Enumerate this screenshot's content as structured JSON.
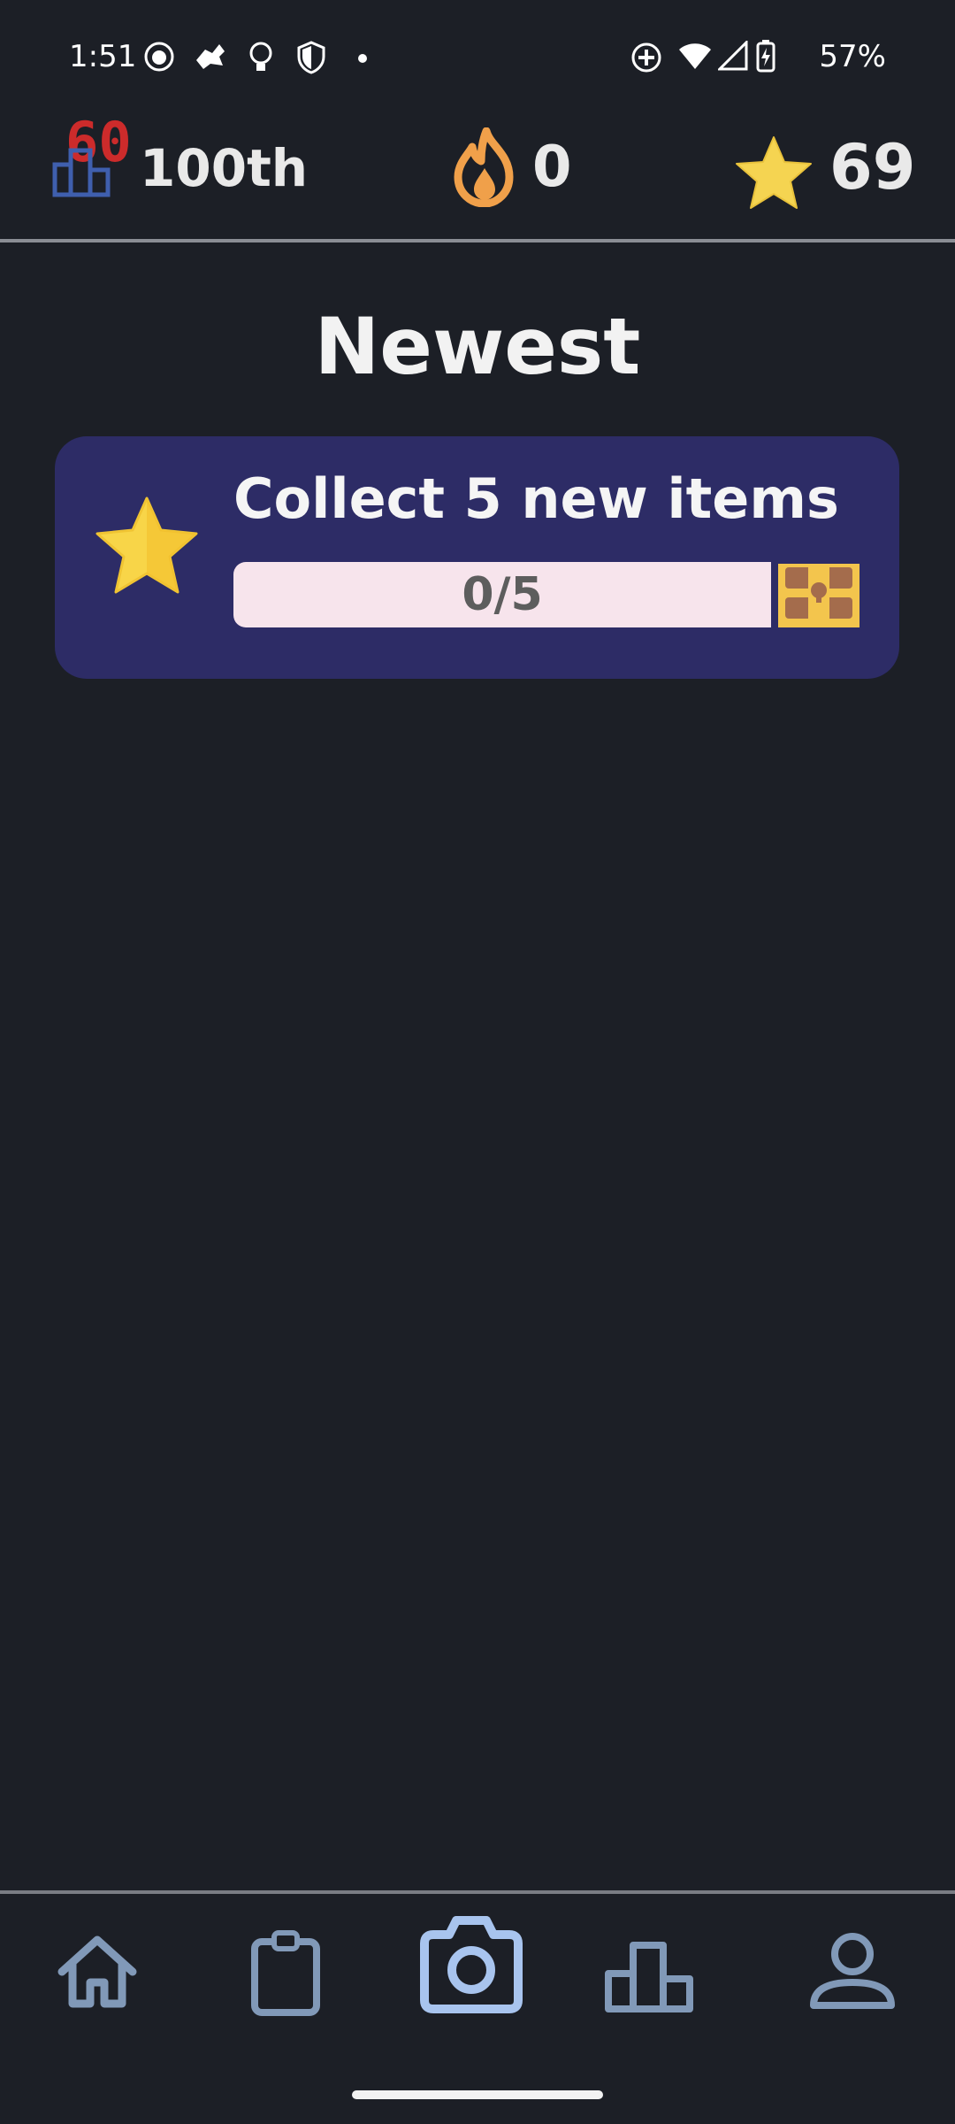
{
  "status_bar": {
    "time": "1:51",
    "battery": "57%",
    "icons_left": [
      "cat-icon",
      "bird-icon",
      "lightbulb-icon",
      "shield-icon",
      "dot-icon"
    ],
    "icons_right": [
      "location-icon",
      "wifi-icon",
      "cell-signal-icon",
      "battery-charging-icon"
    ]
  },
  "stats": {
    "rank": "100th",
    "rank_badge": "60",
    "streak": "0",
    "stars": "69"
  },
  "main": {
    "title": "Newest",
    "quests": [
      {
        "title": "Collect 5 new items",
        "progress_text": "0/5",
        "progress": 0.0,
        "reward": "treasure-chest-icon"
      }
    ]
  },
  "nav": {
    "items": [
      "home-icon",
      "clipboard-icon",
      "camera-icon",
      "leaderboard-icon",
      "profile-icon"
    ],
    "active": "camera-icon"
  },
  "colors": {
    "background": "#1c1f26",
    "card": "#2d2c66",
    "progress_track": "#f7e4ec",
    "nav_icon": "#8199b8",
    "nav_icon_active": "#a8c4ee",
    "streak": "#f0a04a",
    "star": "#f5d451"
  }
}
